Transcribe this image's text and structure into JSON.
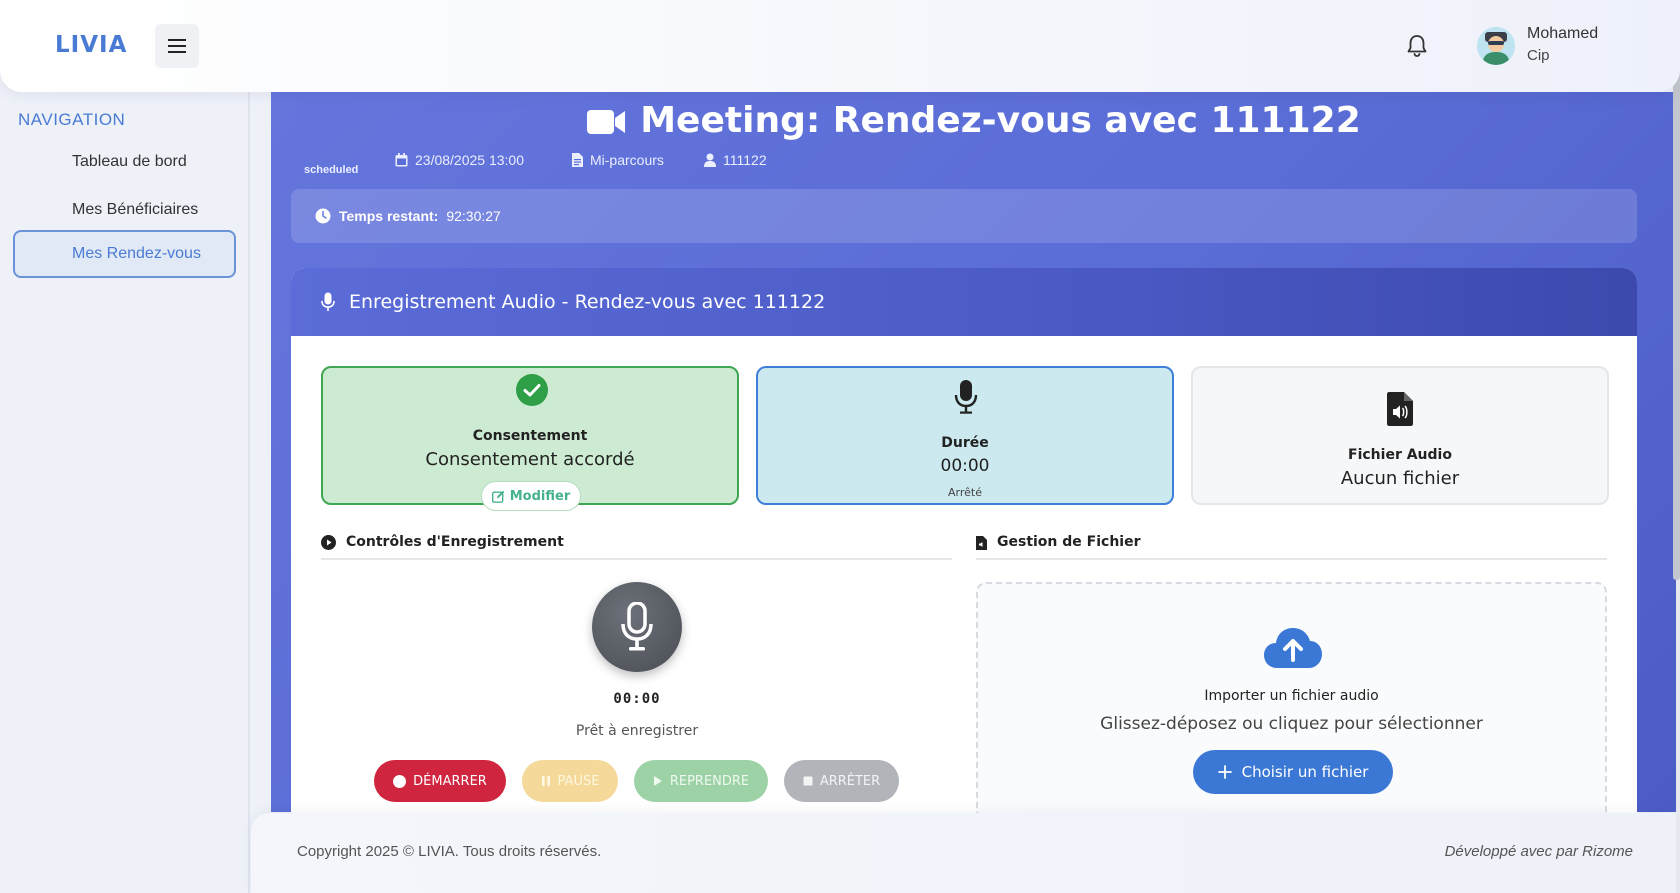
{
  "header": {
    "logo": "LIVIA",
    "user_first": "Mohamed",
    "user_last": "Cip"
  },
  "sidebar": {
    "title": "NAVIGATION",
    "items": [
      {
        "label": "Tableau de bord",
        "active": false
      },
      {
        "label": "Mes Bénéficiaires",
        "active": false
      },
      {
        "label": "Mes Rendez-vous",
        "active": true
      }
    ]
  },
  "meeting": {
    "title": "Meeting: Rendez-vous avec 111122",
    "status": "scheduled",
    "datetime": "23/08/2025 13:00",
    "type": "Mi-parcours",
    "beneficiary": "111122",
    "remaining_label": "Temps restant:",
    "remaining_value": "92:30:27"
  },
  "recording": {
    "header": "Enregistrement Audio - Rendez-vous avec 111122",
    "consent": {
      "label": "Consentement",
      "value": "Consentement accordé",
      "modify": "Modifier"
    },
    "duration": {
      "label": "Durée",
      "value": "00:00",
      "sub": "Arrêté"
    },
    "file": {
      "label": "Fichier Audio",
      "value": "Aucun fichier"
    },
    "controls_title": "Contrôles d'Enregistrement",
    "timer": "00:00",
    "status": "Prêt à enregistrer",
    "buttons": {
      "start": "DÉMARRER",
      "pause": "PAUSE",
      "resume": "REPRENDRE",
      "stop": "ARRÊTER"
    },
    "file_title": "Gestion de Fichier",
    "import_title": "Importer un fichier audio",
    "import_sub": "Glissez-déposez ou cliquez pour sélectionner",
    "choose": "Choisir un fichier"
  },
  "footer": {
    "copyright": "Copyright 2025 © LIVIA. Tous droits réservés.",
    "dev": "Développé avec par Rizome"
  },
  "colors": {
    "brand": "#4a7bd4",
    "main_gradient": "#5a6cd6",
    "consent_green": "#3fa653",
    "duration_blue": "#3f7fd9",
    "start_red": "#d0253f",
    "choose_blue": "#3b78d6"
  }
}
